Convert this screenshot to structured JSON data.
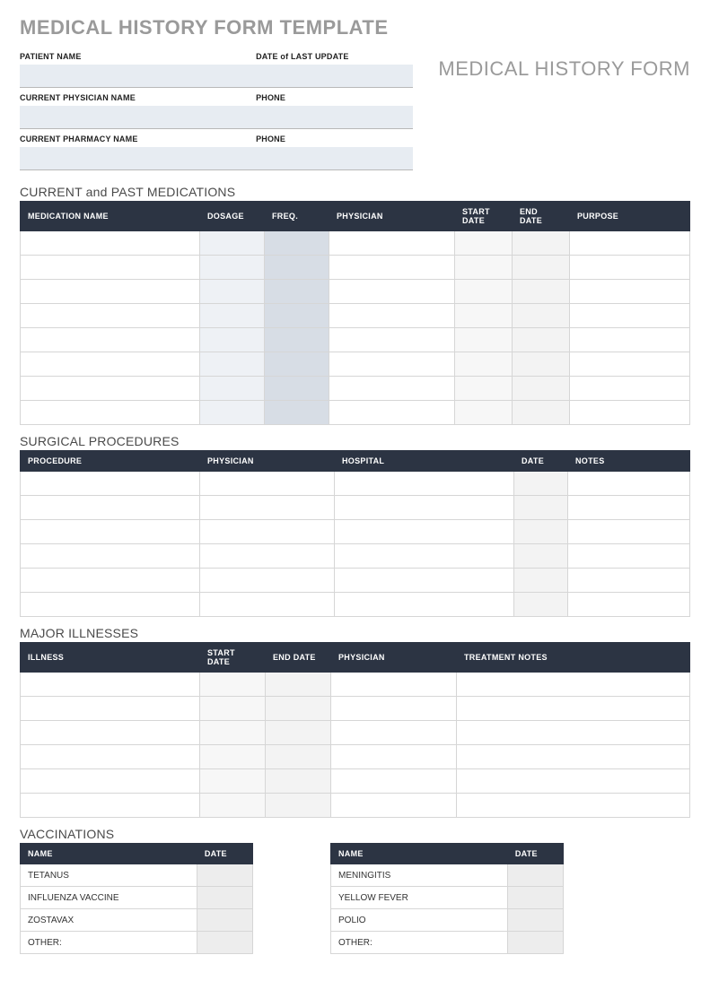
{
  "page_title": "MEDICAL HISTORY FORM TEMPLATE",
  "form_title": "MEDICAL HISTORY FORM",
  "info": {
    "patient_name_label": "PATIENT NAME",
    "patient_name": "",
    "last_update_label": "DATE of LAST UPDATE",
    "last_update": "",
    "physician_name_label": "CURRENT PHYSICIAN NAME",
    "physician_name": "",
    "physician_phone_label": "PHONE",
    "physician_phone": "",
    "pharmacy_name_label": "CURRENT PHARMACY NAME",
    "pharmacy_name": "",
    "pharmacy_phone_label": "PHONE",
    "pharmacy_phone": ""
  },
  "sections": {
    "medications": {
      "title": "CURRENT and PAST MEDICATIONS",
      "headers": [
        "MEDICATION NAME",
        "DOSAGE",
        "FREQ.",
        "PHYSICIAN",
        "START DATE",
        "END DATE",
        "PURPOSE"
      ],
      "rows": 8
    },
    "surgical": {
      "title": "SURGICAL PROCEDURES",
      "headers": [
        "PROCEDURE",
        "PHYSICIAN",
        "HOSPITAL",
        "DATE",
        "NOTES"
      ],
      "rows": 6
    },
    "illnesses": {
      "title": "MAJOR ILLNESSES",
      "headers": [
        "ILLNESS",
        "START DATE",
        "END DATE",
        "PHYSICIAN",
        "TREATMENT NOTES"
      ],
      "rows": 6
    },
    "vaccinations": {
      "title": "VACCINATIONS",
      "headers": [
        "NAME",
        "DATE"
      ],
      "left": [
        "TETANUS",
        "INFLUENZA VACCINE",
        "ZOSTAVAX",
        "OTHER:"
      ],
      "right": [
        "MENINGITIS",
        "YELLOW FEVER",
        "POLIO",
        "OTHER:"
      ]
    }
  }
}
